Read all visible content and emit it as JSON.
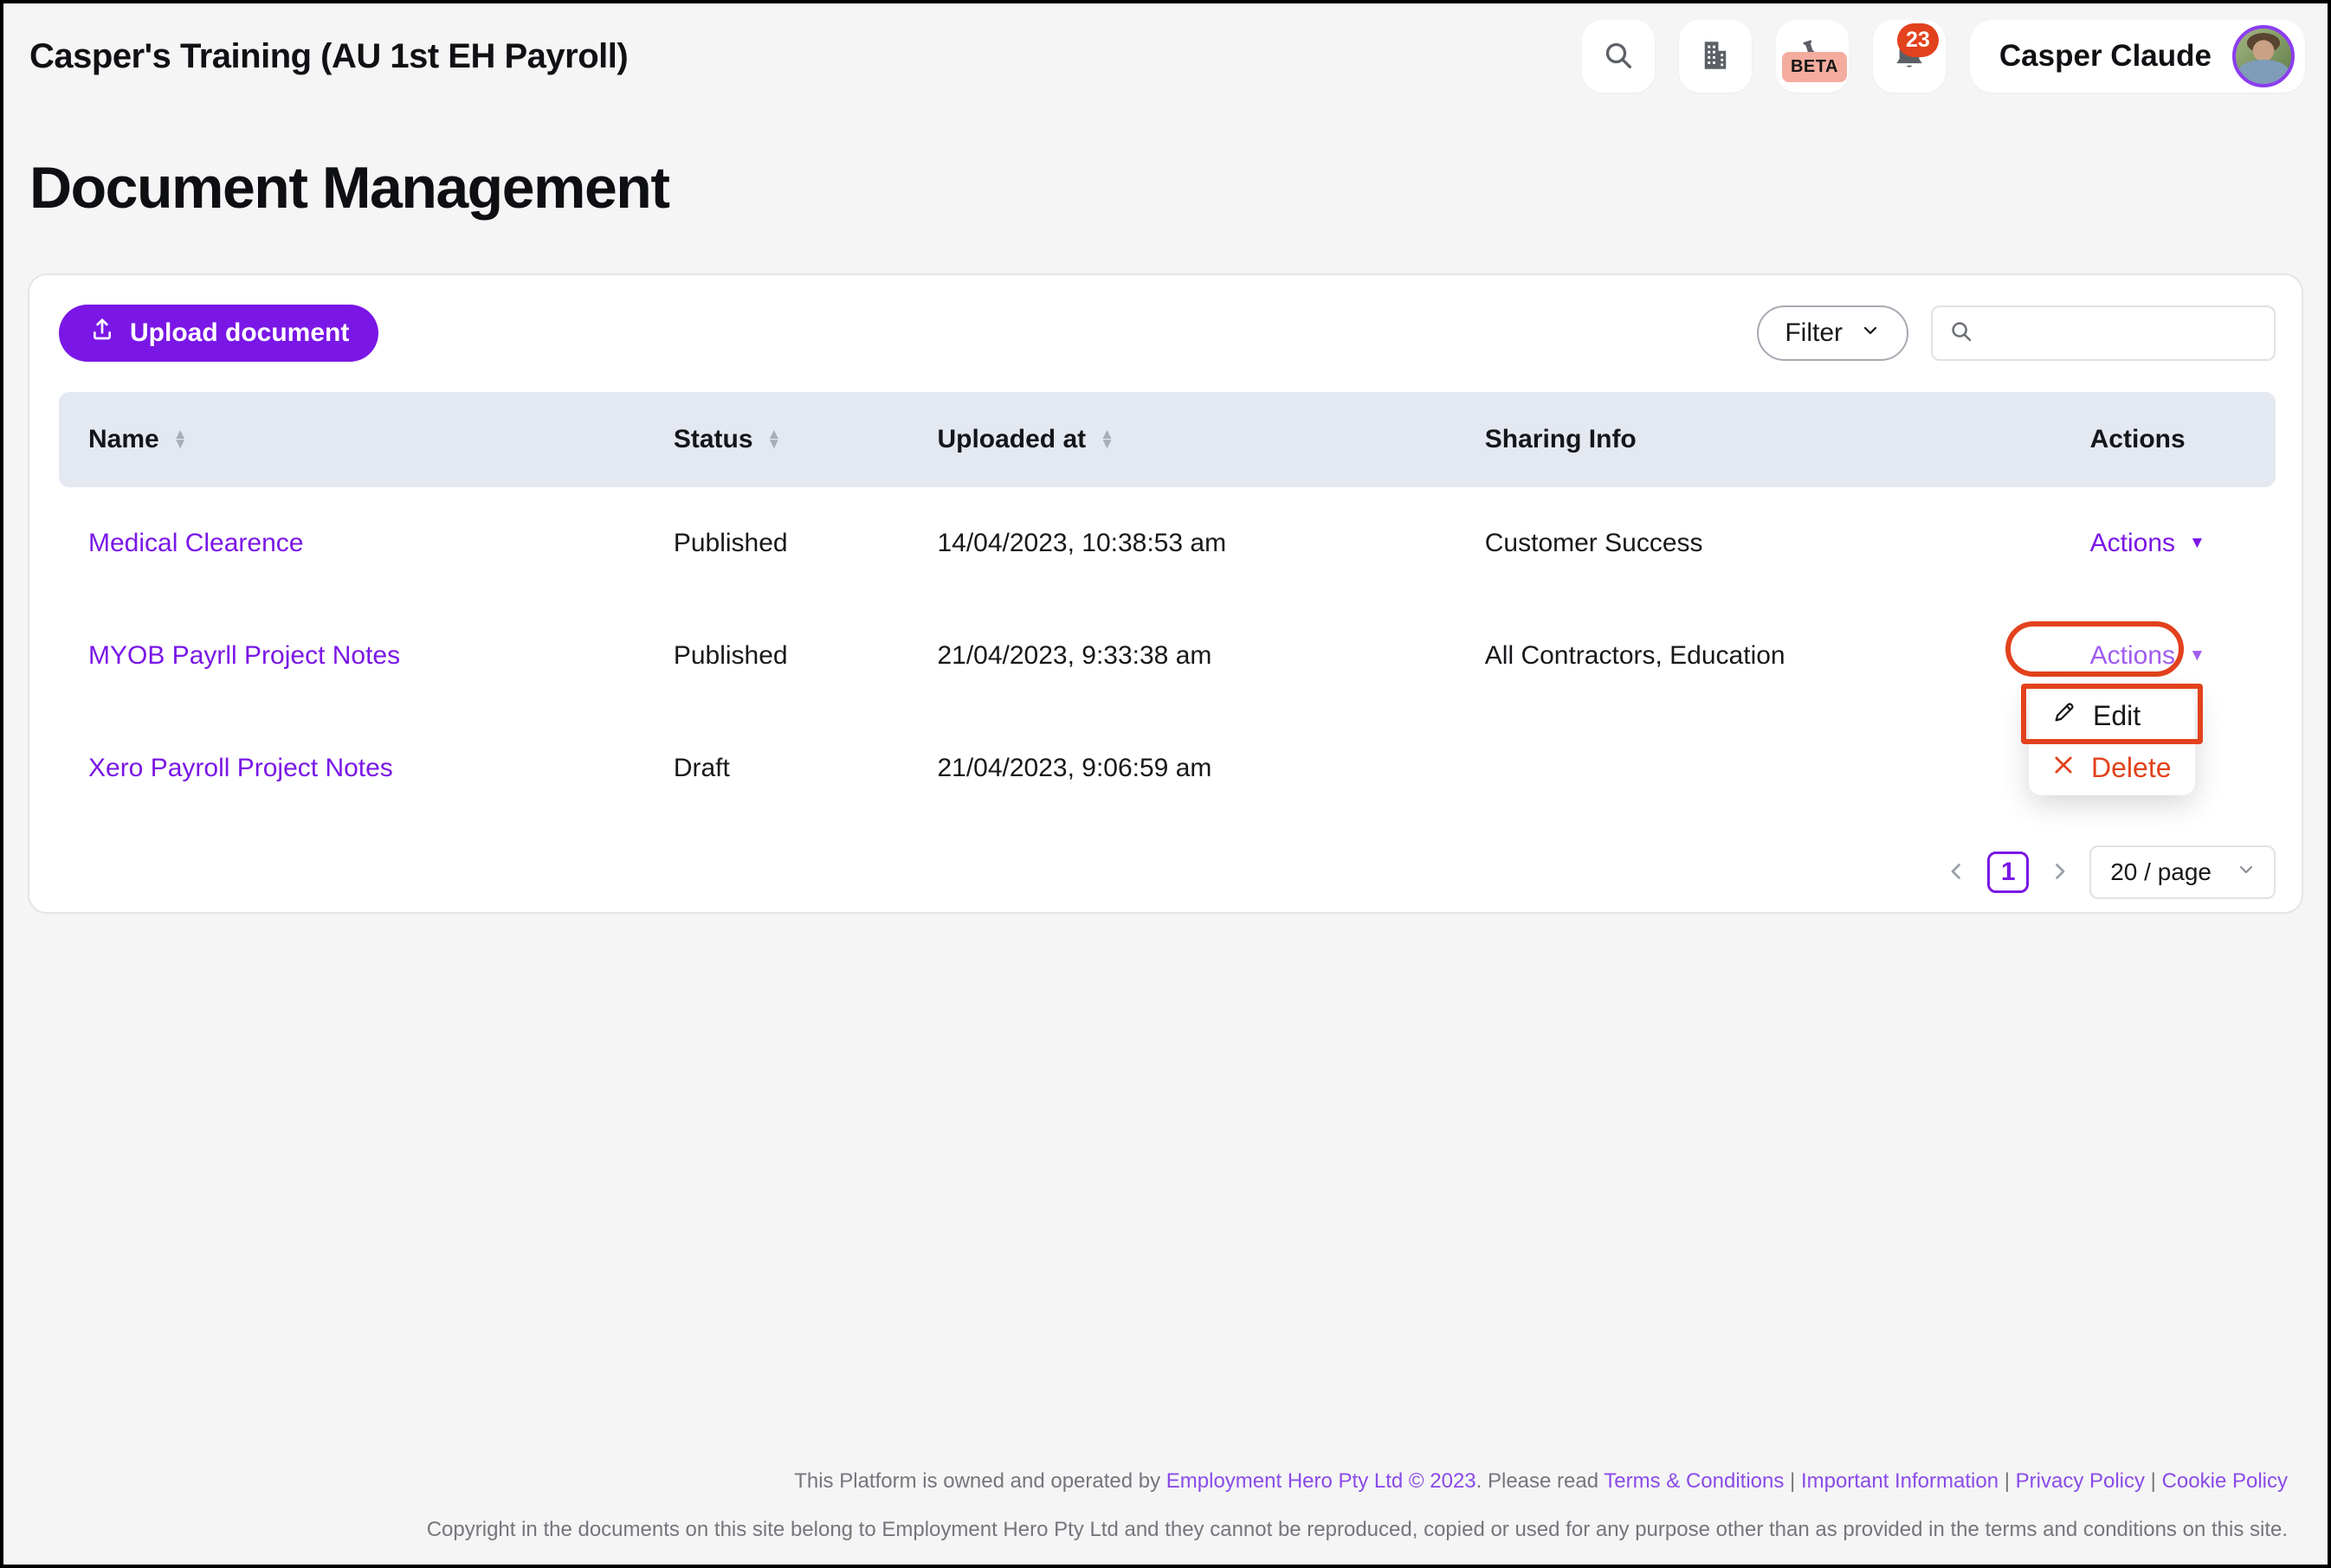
{
  "topbar": {
    "org_title": "Casper's Training (AU 1st EH Payroll)",
    "icons": [
      "search-icon",
      "organisation-icon",
      "beta-flask-icon",
      "notifications-bell-icon"
    ],
    "beta_label": "BETA",
    "notification_count": "23",
    "user_name": "Casper Claude"
  },
  "page": {
    "title": "Document Management"
  },
  "toolbar": {
    "upload_label": "Upload document",
    "filter_label": "Filter",
    "search_value": ""
  },
  "table": {
    "columns": [
      {
        "label": "Name",
        "sortable": true
      },
      {
        "label": "Status",
        "sortable": true
      },
      {
        "label": "Uploaded at",
        "sortable": true
      },
      {
        "label": "Sharing Info",
        "sortable": false
      },
      {
        "label": "Actions",
        "sortable": false
      }
    ],
    "rows": [
      {
        "name": "Medical Clearence",
        "status": "Published",
        "uploaded_at": "14/04/2023, 10:38:53 am",
        "sharing_info": "Customer Success",
        "actions": "Actions"
      },
      {
        "name": "MYOB Payrll Project Notes",
        "status": "Published",
        "uploaded_at": "21/04/2023, 9:33:38 am",
        "sharing_info": "All Contractors, Education",
        "actions": "Actions"
      },
      {
        "name": "Xero Payroll Project Notes",
        "status": "Draft",
        "uploaded_at": "21/04/2023, 9:06:59 am",
        "sharing_info": "",
        "actions": ""
      }
    ]
  },
  "menu": {
    "edit_label": "Edit",
    "delete_label": "Delete"
  },
  "pagination": {
    "current_page": "1",
    "page_size_label": "20 / page"
  },
  "footer": {
    "line1_prefix": "This Platform is owned and operated by ",
    "company_link": "Employment Hero Pty Ltd © 2023",
    "line1_mid": ". Please read ",
    "terms_link": "Terms & Conditions",
    "separator": " | ",
    "important_link": "Important Information",
    "privacy_link": "Privacy Policy",
    "cookie_link": "Cookie Policy",
    "line2": "Copyright in the documents on this site belong to Employment Hero Pty Ltd and they cannot be reproduced, copied or used for any purpose other than as provided in the terms and conditions on this site."
  },
  "colors": {
    "accent_purple": "#7A17E6",
    "hover_purple": "#A05CF0",
    "annotation_red": "#E2421D",
    "delete_red": "#E2421D",
    "table_header_bg": "#E4E8F1",
    "notification_badge": "#E2421D",
    "beta_badge_bg": "#F4AC9F"
  }
}
